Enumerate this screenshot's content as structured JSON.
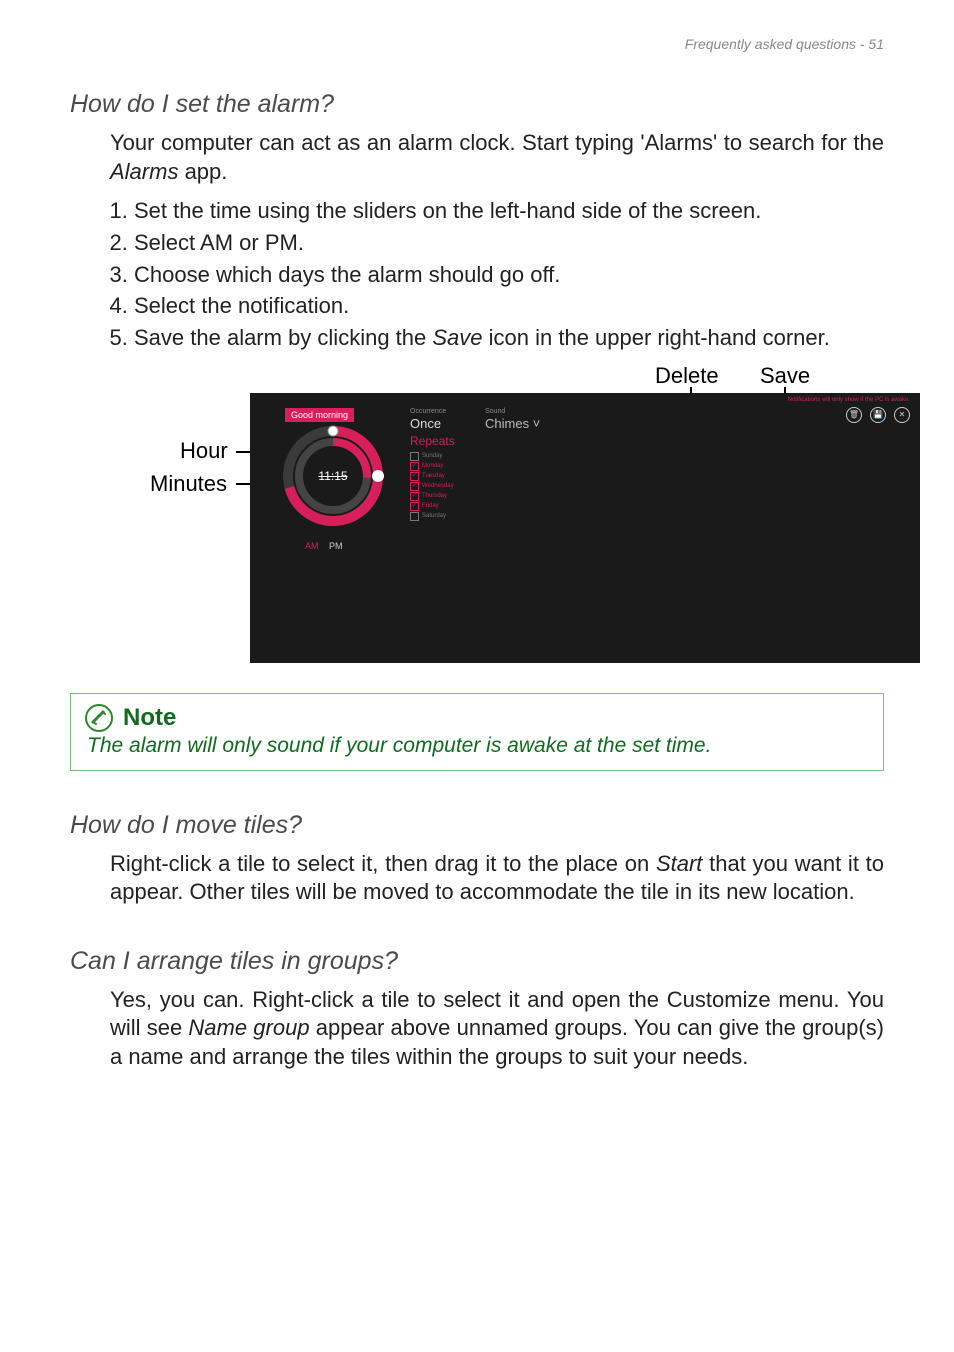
{
  "running_head": "Frequently asked questions - 51",
  "s1": {
    "title": "How do I set the alarm?",
    "intro_a": "Your computer can act as an alarm clock. Start typing 'Alarms' to search for the ",
    "intro_em": "Alarms",
    "intro_b": " app.",
    "steps": {
      "1": "Set the time using the sliders on the left-hand side of the screen.",
      "2": "Select AM or PM.",
      "3": "Choose which days the alarm should go off.",
      "4": "Select the notification.",
      "5a": "Save the alarm by clicking the ",
      "5em": "Save",
      "5b": " icon in the upper right-hand corner."
    }
  },
  "diagram": {
    "labels": {
      "delete": "Delete",
      "save": "Save",
      "hour": "Hour",
      "minutes": "Minutes"
    },
    "screen": {
      "good_morning": "Good morning",
      "time": "11:15",
      "am": "AM",
      "pm": "PM",
      "occurrence_hdr": "Occurrence",
      "once": "Once",
      "repeats": "Repeats",
      "days": {
        "sun": "Sunday",
        "mon": "Monday",
        "tue": "Tuesday",
        "wed": "Wednesday",
        "thu": "Thursday",
        "fri": "Friday",
        "sat": "Saturday"
      },
      "sound_hdr": "Sound",
      "sound_val": "Chimes ˅",
      "notice": "Notifications will only show if the PC is awake.",
      "icon_delete": "🗑",
      "icon_save": "💾",
      "icon_close": "✕"
    }
  },
  "note": {
    "head": "Note",
    "body": "The alarm will only sound if your computer is awake at the set time."
  },
  "s2": {
    "title": "How do I move tiles?",
    "text_a": "Right-click a tile to select it, then drag it to the place on ",
    "text_em": "Start",
    "text_b": " that you want it to appear. Other tiles will be moved to accommodate the tile in its new location."
  },
  "s3": {
    "title": "Can I arrange tiles in groups?",
    "text_a": "Yes, you can. Right-click a tile to select it and open the Customize menu. You will see ",
    "text_em": "Name group",
    "text_b": " appear above unnamed groups. You can give the group(s) a name and arrange the tiles within the groups to suit your needs."
  }
}
